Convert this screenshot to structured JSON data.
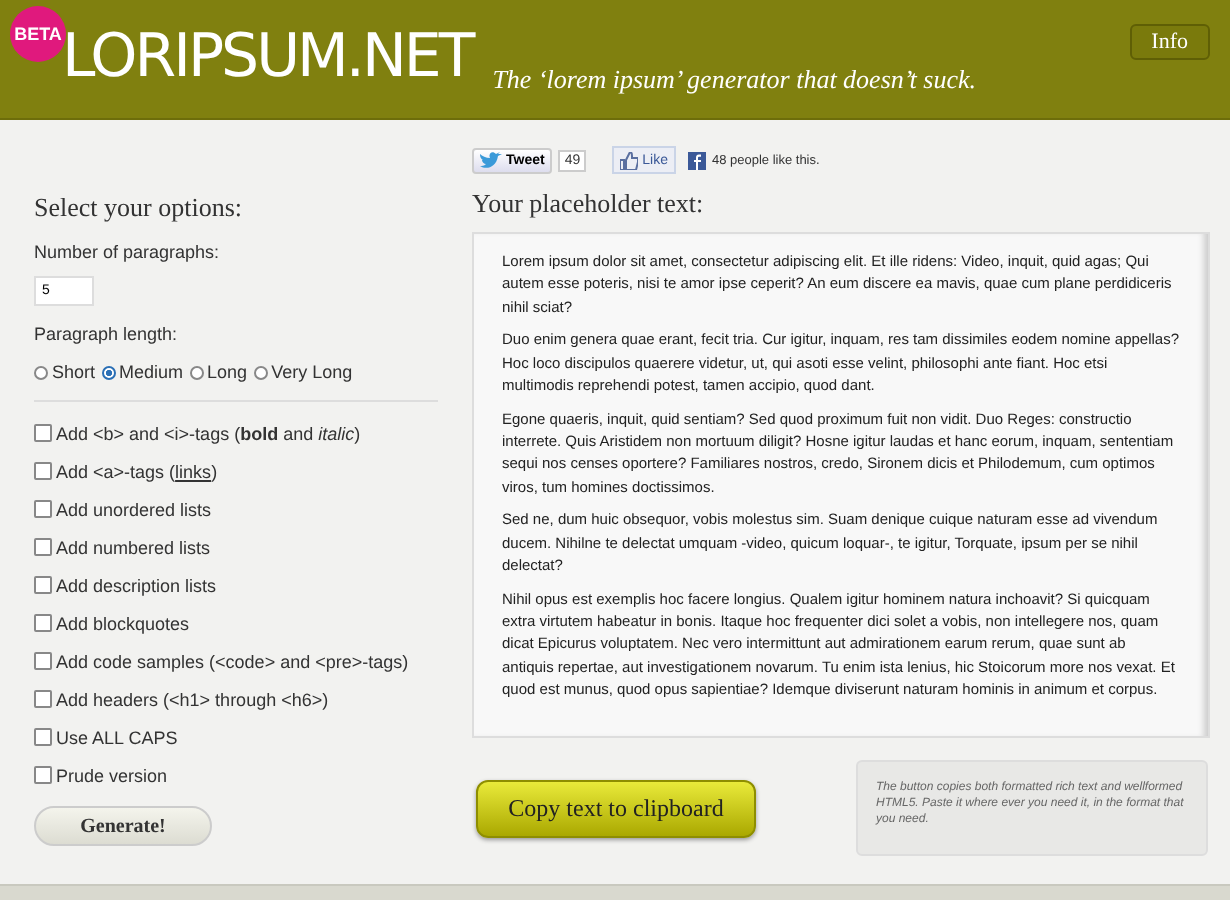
{
  "header": {
    "badge": "BETA",
    "logo": "LORIPSUM.NET",
    "tagline": "The ‘lorem ipsum’ generator that doesn’t suck.",
    "info_button": "Info"
  },
  "social": {
    "tweet": "Tweet",
    "tweet_count": "49",
    "like": "Like",
    "like_text": "48 people like this."
  },
  "options": {
    "title": "Select your options:",
    "paragraphs_label": "Number of paragraphs:",
    "paragraphs_value": "5",
    "length_label": "Paragraph length:",
    "lengths": [
      {
        "label": "Short",
        "selected": false
      },
      {
        "label": "Medium",
        "selected": true
      },
      {
        "label": "Long",
        "selected": false
      },
      {
        "label": "Very Long",
        "selected": false
      }
    ],
    "checkboxes": [
      {
        "label": "Add <b> and <i>-tags (**bold** and *italic*)",
        "checked": false
      },
      {
        "label": "Add <a>-tags (",
        "link": "links",
        "label_after": ")",
        "checked": false
      },
      {
        "label": "Add unordered lists",
        "checked": false
      },
      {
        "label": "Add numbered lists",
        "checked": false
      },
      {
        "label": "Add description lists",
        "checked": false
      },
      {
        "label": "Add blockquotes",
        "checked": false
      },
      {
        "label": "Add code samples (<code> and <pre>-tags)",
        "checked": false
      },
      {
        "label": "Add headers (<h1> through <h6>)",
        "checked": false
      },
      {
        "label": "Use ALL CAPS",
        "checked": false
      },
      {
        "label": "Prude version",
        "checked": false
      }
    ],
    "generate_button": "Generate!"
  },
  "output": {
    "title": "Your placeholder text:",
    "paragraphs": [
      "Lorem ipsum dolor sit amet, consectetur adipiscing elit. Et ille ridens: Video, inquit, quid agas; Qui autem esse poteris, nisi te amor ipse ceperit? An eum discere ea mavis, quae cum plane perdidiceris nihil sciat?",
      "Duo enim genera quae erant, fecit tria. Cur igitur, inquam, res tam dissimiles eodem nomine appellas? Hoc loco discipulos quaerere videtur, ut, qui asoti esse velint, philosophi ante fiant. Hoc etsi multimodis reprehendi potest, tamen accipio, quod dant.",
      "Egone quaeris, inquit, quid sentiam? Sed quod proximum fuit non vidit. Duo Reges: constructio interrete. Quis Aristidem non mortuum diligit? Hosne igitur laudas et hanc eorum, inquam, sententiam sequi nos censes oportere? Familiares nostros, credo, Sironem dicis et Philodemum, cum optimos viros, tum homines doctissimos.",
      "Sed ne, dum huic obsequor, vobis molestus sim. Suam denique cuique naturam esse ad vivendum ducem. Nihilne te delectat umquam -video, quicum loquar-, te igitur, Torquate, ipsum per se nihil delectat?",
      "Nihil opus est exemplis hoc facere longius. Qualem igitur hominem natura inchoavit? Si quicquam extra virtutem habeatur in bonis. Itaque hoc frequenter dici solet a vobis, non intellegere nos, quam dicat Epicurus voluptatem. Nec vero intermittunt aut admirationem earum rerum, quae sunt ab antiquis repertae, aut investigationem novarum. Tu enim ista lenius, hic Stoicorum more nos vexat. Et quod est munus, quod opus sapientiae? Idemque diviserunt naturam hominis in animum et corpus."
    ],
    "copy_button": "Copy text to clipboard",
    "hint": "The button copies both formatted rich text and wellformed HTML5. Paste it where ever you need it, in the format that you need."
  }
}
